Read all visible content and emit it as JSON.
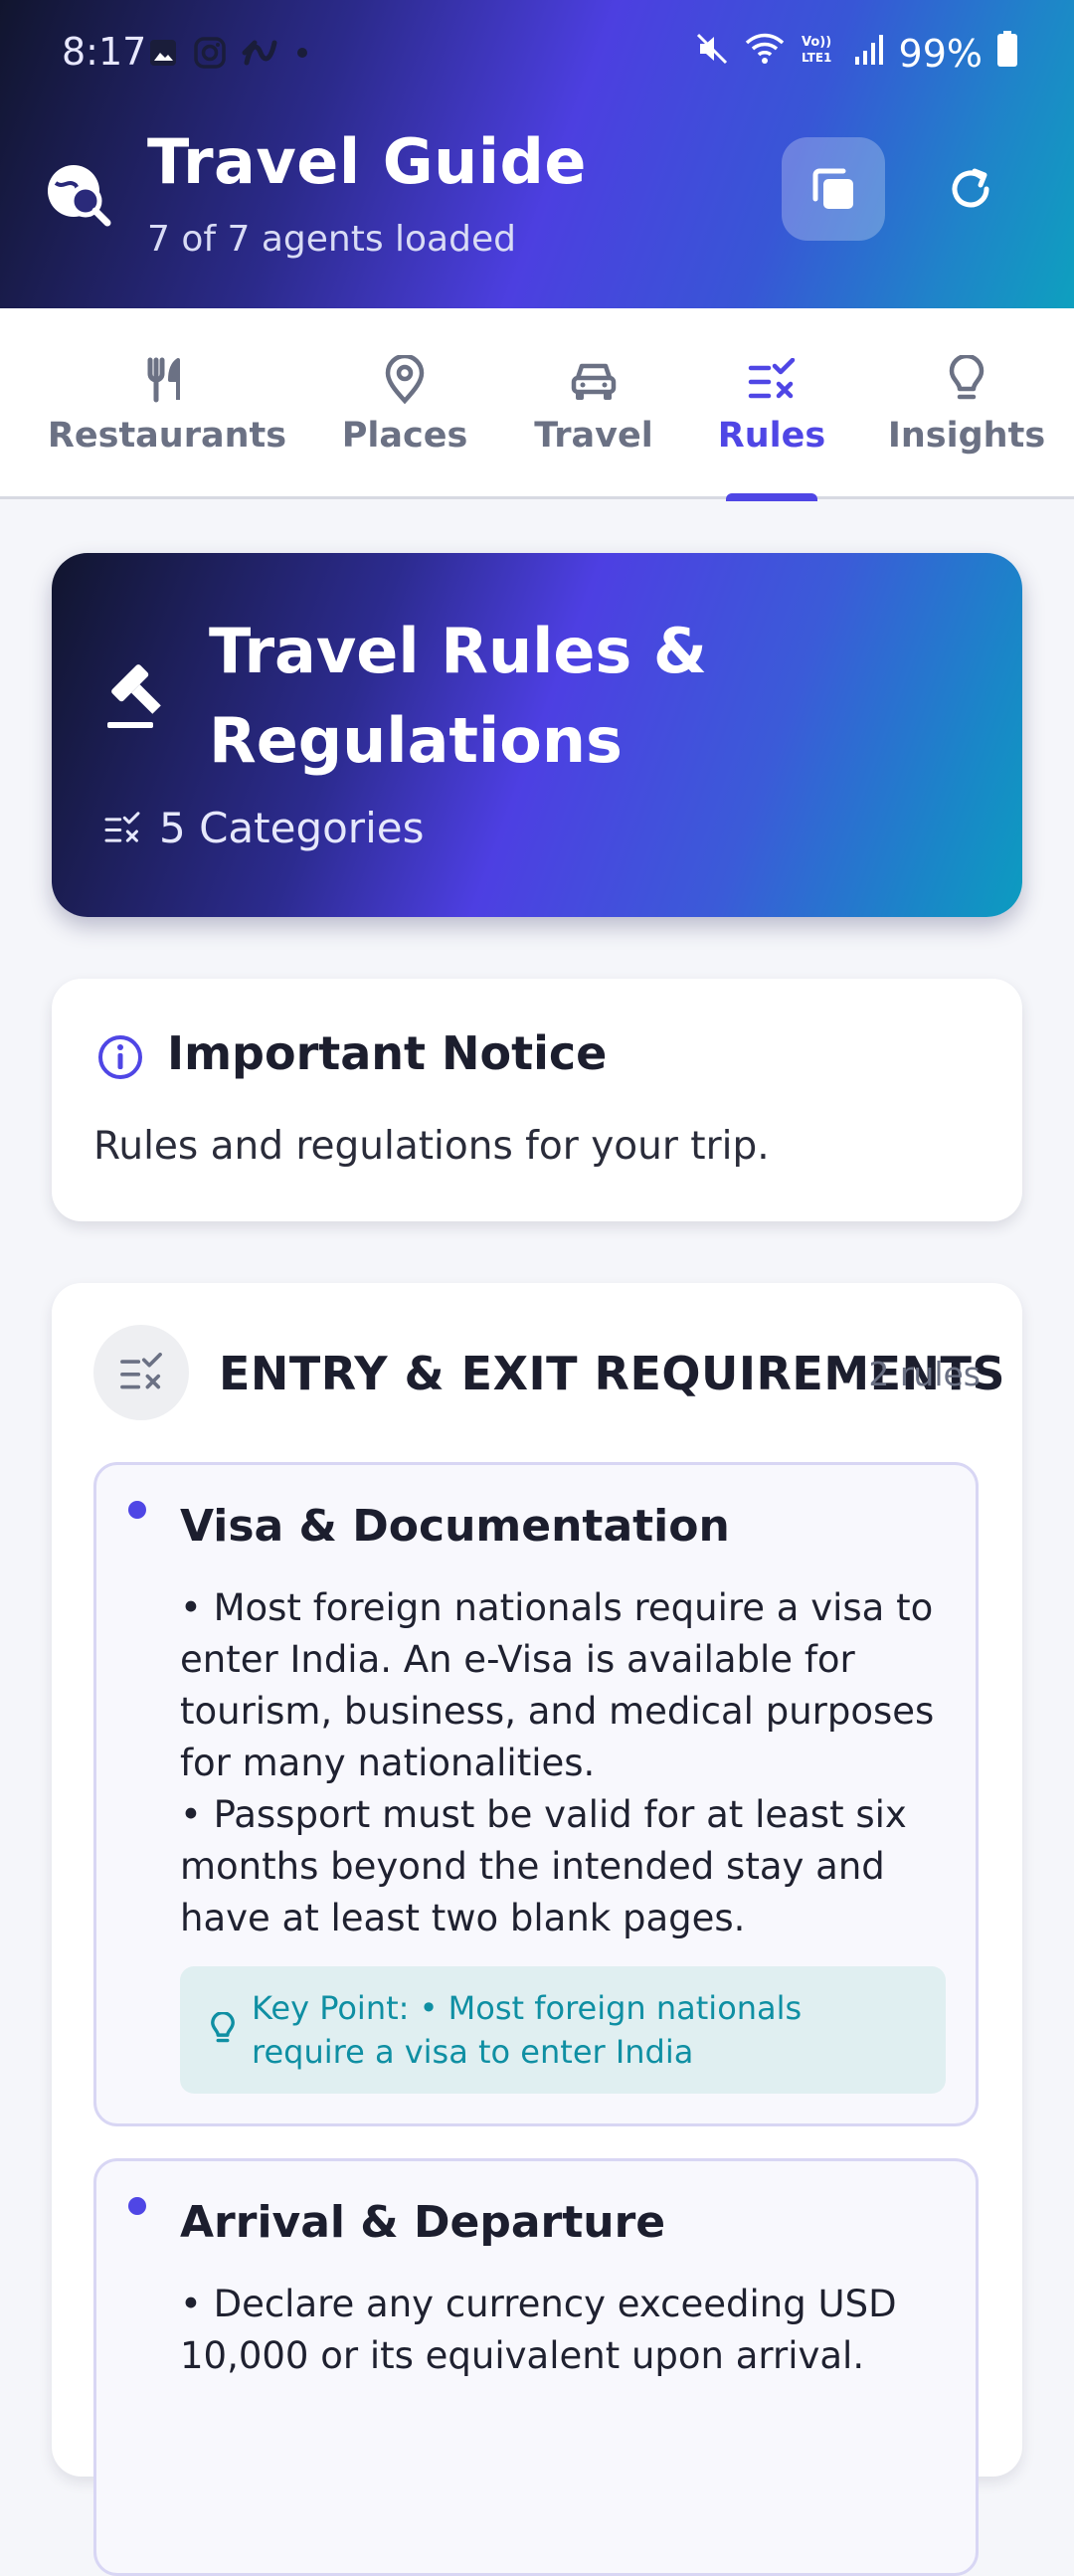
{
  "status_bar": {
    "time": "8:17",
    "battery": "99%",
    "left_icons": [
      "gallery-icon",
      "instagram-icon",
      "app-icon",
      "dot-icon"
    ],
    "right_icons": [
      "mute-icon",
      "wifi-icon",
      "volte-icon",
      "signal-icon",
      "battery-icon"
    ]
  },
  "header": {
    "title": "Travel Guide",
    "subtitle": "7 of 7 agents loaded",
    "logo_icon": "globe-search-icon",
    "actions": [
      "copy-icon",
      "refresh-icon"
    ]
  },
  "tabs": [
    {
      "label": "Restaurants",
      "icon": "utensils-icon",
      "active": false
    },
    {
      "label": "Places",
      "icon": "map-pin-icon",
      "active": false
    },
    {
      "label": "Travel",
      "icon": "car-icon",
      "active": false
    },
    {
      "label": "Rules",
      "icon": "list-check-icon",
      "active": true
    },
    {
      "label": "Insights",
      "icon": "lightbulb-icon",
      "active": false
    }
  ],
  "hero": {
    "title": "Travel Rules & Regulations",
    "meta": "5 Categories",
    "icon": "gavel-icon"
  },
  "notice": {
    "title": "Important Notice",
    "text": "Rules and regulations for your trip.",
    "icon": "info-icon"
  },
  "category": {
    "title": "ENTRY & EXIT REQUIREMENTS",
    "count": "2 rules",
    "rules": [
      {
        "title": "Visa & Documentation",
        "lines": [
          "• Most foreign nationals require a visa to enter India. An e-Visa is available for tourism, business, and medical purposes for many nationalities.",
          "• Passport must be valid for at least six months beyond the intended stay and have at least two blank pages."
        ],
        "key_point": "Key Point: • Most foreign nationals require a visa to enter India"
      },
      {
        "title": "Arrival & Departure",
        "lines": [
          "• Declare any currency exceeding USD 10,000 or its equivalent upon arrival."
        ]
      }
    ]
  },
  "colors": {
    "accent": "#4f46e5",
    "teal": "#0f8fa3",
    "text": "#1c1e2e",
    "muted": "#6b7184"
  }
}
